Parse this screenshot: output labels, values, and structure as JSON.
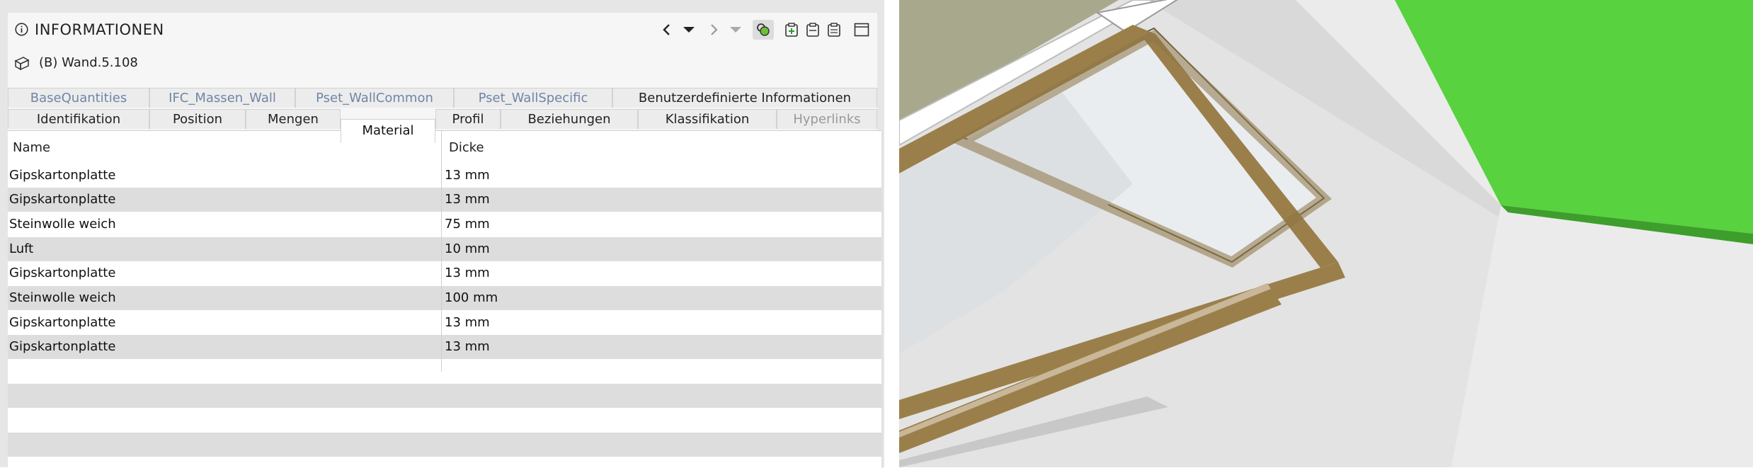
{
  "panel": {
    "title": "INFORMATIONEN",
    "object_name": "(B) Wand.5.108",
    "icons": [
      "info-icon",
      "chevron-left-icon",
      "triangle-down-icon",
      "chevron-right-icon",
      "triangle-down-disabled-icon",
      "highlight-selection-icon",
      "add-clipboard-icon",
      "copy-clipboard-icon",
      "paste-clipboard-icon",
      "dock-panel-icon",
      "wall-object-icon"
    ]
  },
  "tabs": {
    "row1": [
      "BaseQuantities",
      "IFC_Massen_Wall",
      "Pset_WallCommon",
      "Pset_WallSpecific",
      "Benutzerdefinierte Informationen"
    ],
    "row2": [
      "Identifikation",
      "Position",
      "Mengen",
      "Material",
      "Profil",
      "Beziehungen",
      "Klassifikation",
      "Hyperlinks"
    ],
    "active": "Material"
  },
  "table": {
    "headers": [
      "Name",
      "Dicke"
    ],
    "rows": [
      [
        "Gipskartonplatte",
        "13 mm"
      ],
      [
        "Gipskartonplatte",
        "13 mm"
      ],
      [
        "Steinwolle weich",
        "75 mm"
      ],
      [
        "Luft",
        "10 mm"
      ],
      [
        "Gipskartonplatte",
        "13 mm"
      ],
      [
        "Steinwolle weich",
        "100 mm"
      ],
      [
        "Gipskartonplatte",
        "13 mm"
      ],
      [
        "Gipskartonplatte",
        "13 mm"
      ]
    ]
  },
  "colors": {
    "wall_green": "#58d23f",
    "frame_brown": "#9b7f4a",
    "accent_dim_tab": "#6f86a6"
  }
}
